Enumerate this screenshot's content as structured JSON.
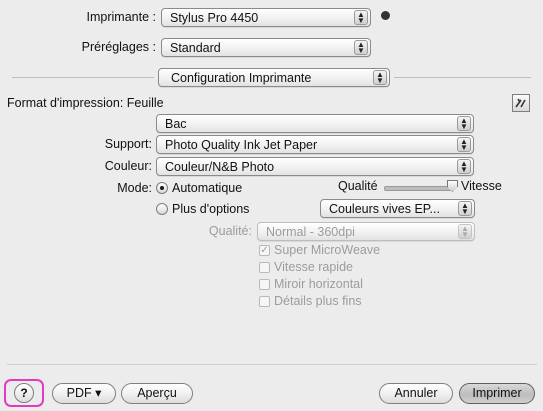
{
  "header": {
    "printer_label": "Imprimante :",
    "printer_value": "Stylus Pro 4450",
    "presets_label": "Préréglages :",
    "presets_value": "Standard",
    "panel_value": "Configuration Imprimante"
  },
  "settings": {
    "format_label": "Format d'impression:",
    "format_value": "Feuille",
    "source_value": "Bac",
    "support_label": "Support:",
    "support_value": "Photo Quality Ink Jet Paper",
    "color_label": "Couleur:",
    "color_value": "Couleur/N&B Photo",
    "mode_label": "Mode:",
    "mode_auto": "Automatique",
    "quality_label": "Qualité",
    "speed_label": "Vitesse",
    "slider_level": 1.0,
    "mode_more": "Plus d'options",
    "color_mode_value": "Couleurs vives EP...",
    "quality_field_label": "Qualité:",
    "quality_field_value": "Normal - 360dpi",
    "options": [
      {
        "label": "Super MicroWeave",
        "checked": true
      },
      {
        "label": "Vitesse rapide",
        "checked": false
      },
      {
        "label": "Miroir horizontal",
        "checked": false
      },
      {
        "label": "Détails plus fins",
        "checked": false
      }
    ]
  },
  "footer": {
    "help_label": "?",
    "pdf_label": "PDF ▾",
    "preview_label": "Aperçu",
    "cancel_label": "Annuler",
    "print_label": "Imprimer"
  },
  "colors": {
    "highlight": "#e23bc2"
  }
}
